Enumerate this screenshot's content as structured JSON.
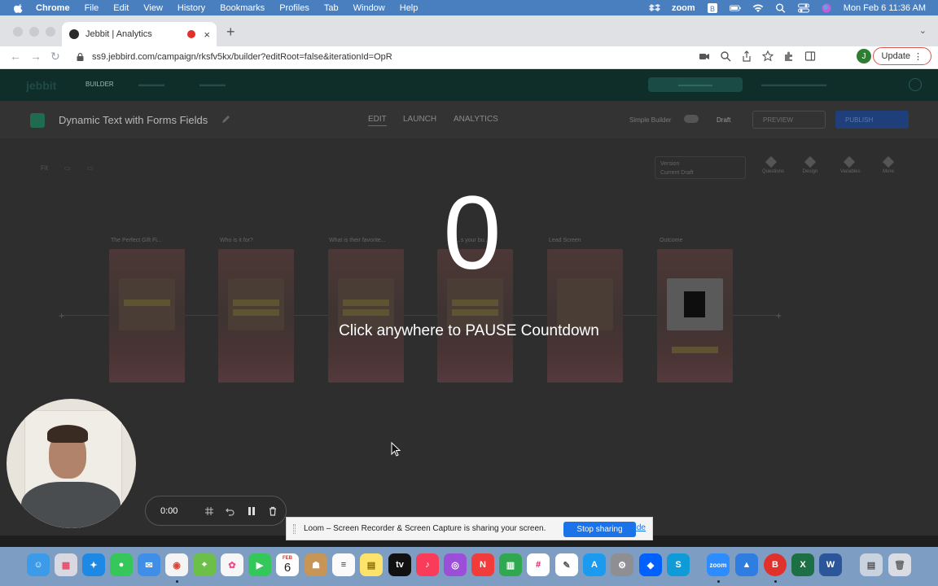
{
  "menubar": {
    "app": "Chrome",
    "items": [
      "File",
      "Edit",
      "View",
      "History",
      "Bookmarks",
      "Profiles",
      "Tab",
      "Window",
      "Help"
    ],
    "status_zoom": "zoom",
    "clock": "Mon Feb 6  11:36 AM"
  },
  "browser": {
    "tab_title": "Jebbit | Analytics",
    "url": "ss9.jebbird.com/campaign/rksfv5kx/builder?editRoot=false&iterationId=OpR",
    "avatar_letter": "J",
    "update_label": "Update"
  },
  "app": {
    "nav_builder": "BUILDER",
    "project_title": "Dynamic Text with Forms Fields",
    "tabs": [
      "EDIT",
      "LAUNCH",
      "ANALYTICS"
    ],
    "simple_builder": "Simple Builder",
    "draft": "Draft",
    "preview": "PREVIEW",
    "publish": "PUBLISH",
    "version_label": "Version",
    "version_value": "Current Draft",
    "tools": [
      "Questions",
      "Design",
      "Variables",
      "More"
    ],
    "cards": [
      {
        "label": "The Perfect Gift Fi..."
      },
      {
        "label": "Who is it for?"
      },
      {
        "label": "What is their favorite..."
      },
      {
        "label": "...s your bu..."
      },
      {
        "label": "Lead Screen"
      },
      {
        "label": "Outcome"
      }
    ]
  },
  "overlay": {
    "countdown": "0",
    "message": "Click anywhere to PAUSE Countdown"
  },
  "loom": {
    "timer": "0:00",
    "share_message": "Loom – Screen Recorder & Screen Capture is sharing your screen.",
    "stop_label": "Stop sharing",
    "hide_label": "Hide"
  },
  "dock": {
    "calendar_day": "6",
    "calendar_month": "FEB"
  },
  "colors": {
    "menubar": "#4a7fbf",
    "stop_button": "#1a73e8",
    "record_dot": "#e0312b"
  }
}
